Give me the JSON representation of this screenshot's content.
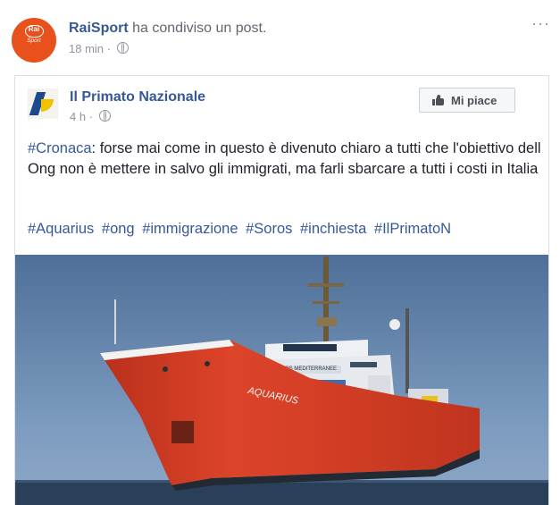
{
  "outer": {
    "avatar_top": "Rai",
    "avatar_bottom": "Sport",
    "page_name": "RaiSport",
    "action": "ha condiviso un post.",
    "time": "18 min",
    "dot": "·",
    "more": "···"
  },
  "inner": {
    "page_name": "Il Primato Nazionale",
    "time": "4 h",
    "dot": "·",
    "like_label": "Mi piace",
    "text_tag": "#Cronaca",
    "text_body": ": forse mai come in questo è divenuto chiaro a tutti che l'obiettivo dell Ong non è mettere in salvo gli immigrati, ma farli sbarcare a tutti i costi in Italia",
    "hashtags": [
      "#Aquarius",
      "#ong",
      "#immigrazione",
      "#Soros",
      "#inchiesta",
      "#IlPrimatoN"
    ],
    "photo": {
      "ship_name": "AQUARIUS",
      "banner": "SOS MEDITERRANEE",
      "colors": {
        "sky": "#5d7ea6",
        "hull": "#d63a22",
        "sea": "#2a3f58"
      }
    }
  }
}
